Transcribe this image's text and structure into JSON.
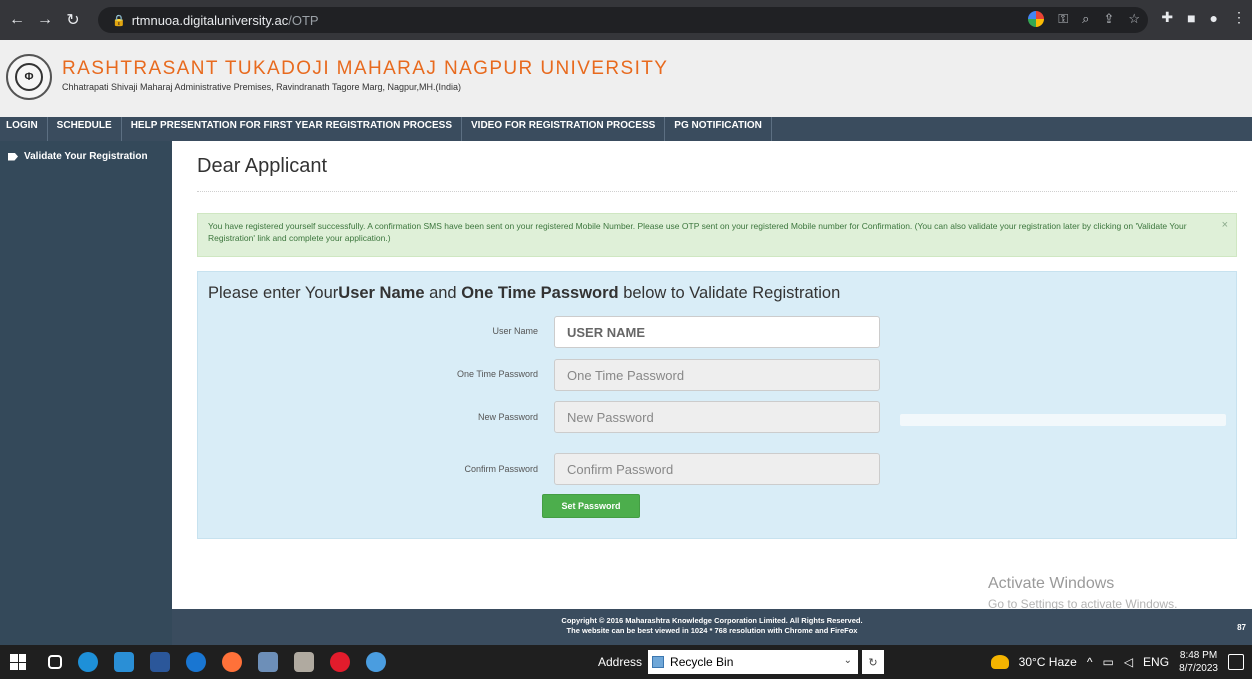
{
  "browser": {
    "url_host": "rtmnuoa.digitaluniversity.ac",
    "url_path": "/OTP"
  },
  "header": {
    "university_name": "RASHTRASANT TUKADOJI MAHARAJ NAGPUR UNIVERSITY",
    "address": "Chhatrapati Shivaji Maharaj Administrative Premises, Ravindranath Tagore Marg, Nagpur,MH.(India)"
  },
  "menu": {
    "items": [
      {
        "label": "LOGIN"
      },
      {
        "label": "SCHEDULE"
      },
      {
        "label": "HELP PRESENTATION FOR FIRST YEAR REGISTRATION PROCESS"
      },
      {
        "label": "VIDEO FOR REGISTRATION PROCESS"
      },
      {
        "label": "PG NOTIFICATION"
      }
    ]
  },
  "sidebar": {
    "items": [
      {
        "label": "Validate Your Registration"
      }
    ]
  },
  "main": {
    "title": "Dear  Applicant",
    "alert_text": "You have registered yourself successfully. A confirmation SMS have been sent on your registered Mobile Number. Please use OTP sent on your registered Mobile number for Confirmation. (You can also validate your registration later by clicking on 'Validate Your Registration' link and complete your application.)",
    "alert_close": "×",
    "panel": {
      "heading_prefix": "Please enter Your",
      "heading_bold1": "User Name",
      "heading_mid": " and ",
      "heading_bold2": "One Time Password",
      "heading_suffix": " below to Validate Registration",
      "fields": {
        "username": {
          "label": "User Name",
          "value": "USER NAME"
        },
        "otp": {
          "label": "One Time Password",
          "placeholder": "One Time Password"
        },
        "new_password": {
          "label": "New Password",
          "placeholder": "New Password"
        },
        "confirm_password": {
          "label": "Confirm Password",
          "placeholder": "Confirm Password"
        }
      },
      "submit_label": "Set Password"
    }
  },
  "watermark": {
    "line1": "Activate Windows",
    "line2": "Go to Settings to activate Windows."
  },
  "footer": {
    "copyright": "Copyright © 2016 Maharashtra Knowledge Corporation Limited. All Rights Reserved.",
    "best_viewed": "The website can be best viewed in 1024 * 768 resolution with Chrome and FireFox",
    "page_number": "87"
  },
  "taskbar": {
    "address_label": "Address",
    "address_value": "Recycle Bin",
    "weather": "30°C  Haze",
    "language": "ENG",
    "time": "8:48 PM",
    "date": "8/7/2023"
  }
}
